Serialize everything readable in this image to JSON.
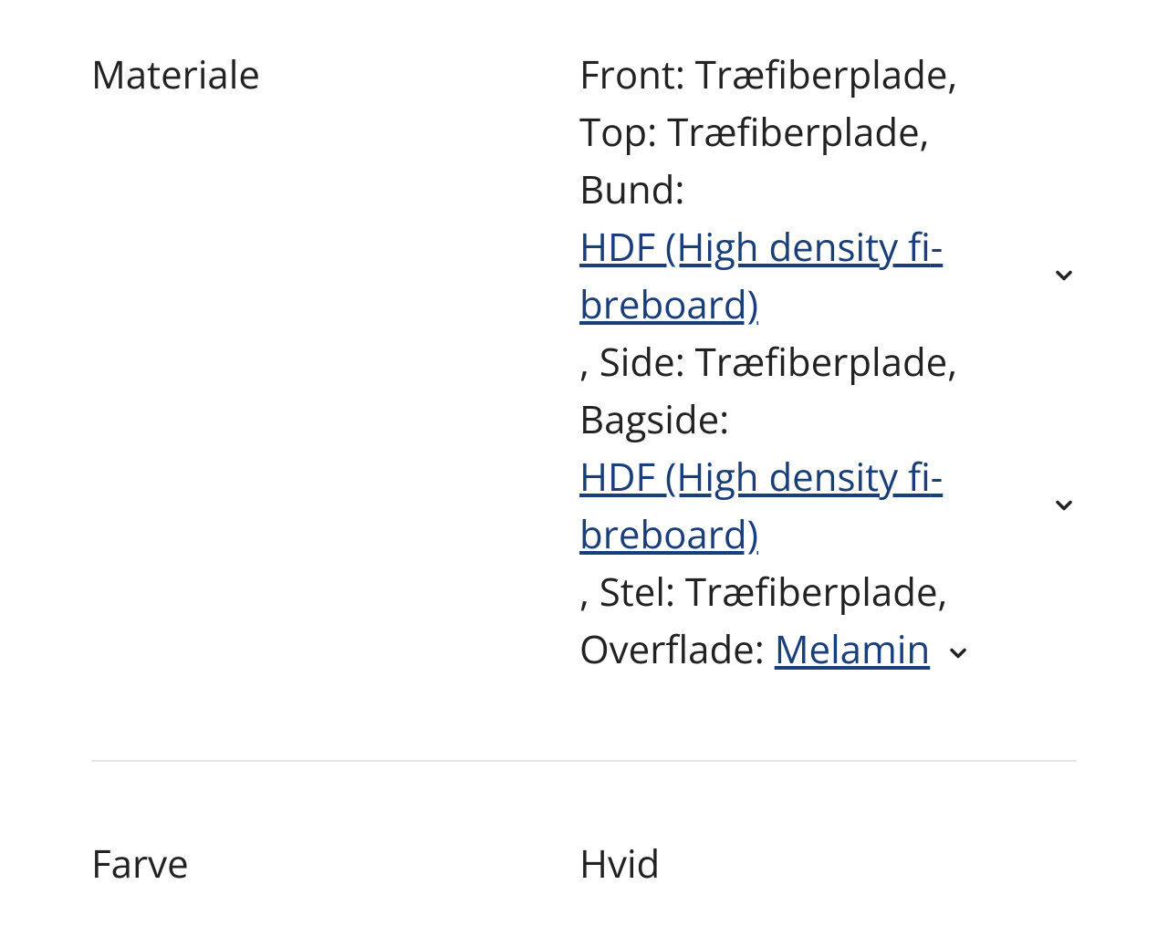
{
  "specs": {
    "material": {
      "label": "Materiale",
      "front_label": "Front:",
      "front_value": "Træfiberplade,",
      "top_label": "Top:",
      "top_value": "Træfiberplade,",
      "bund_label": "Bund:",
      "bund_link": "HDF (High density fi­breboard)",
      "side_prefix": ", Side:",
      "side_value": "Træfiberplade,",
      "bagside_label": "Bagside:",
      "bagside_link": "HDF (High density fi­breboard)",
      "stel_prefix": ", Stel:",
      "stel_value": "Træfiberplade,",
      "overflade_label": "Overflade:",
      "overflade_link": "Melamin"
    },
    "color": {
      "label": "Farve",
      "value": "Hvid"
    }
  }
}
